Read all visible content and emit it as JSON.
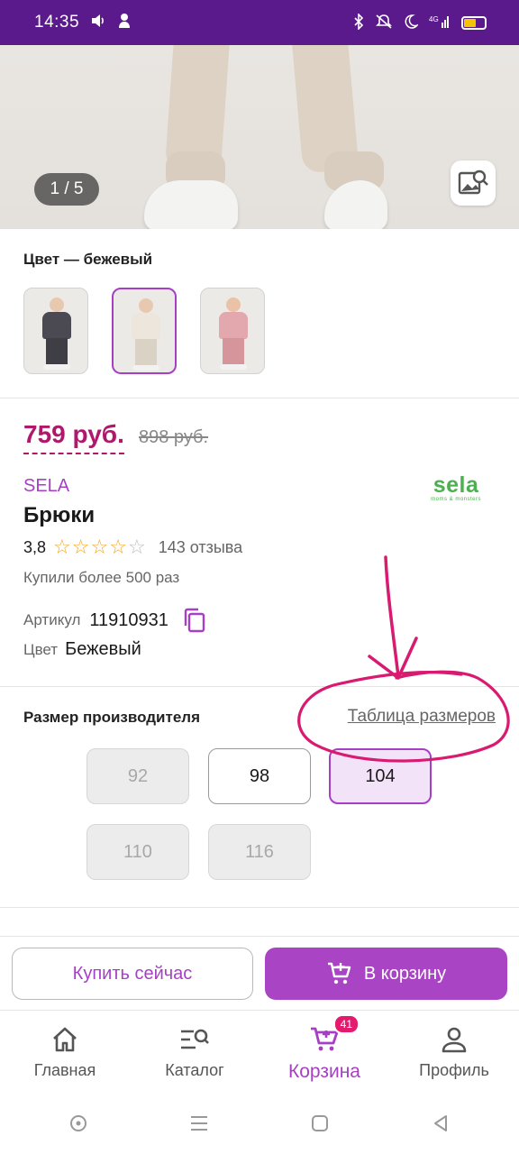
{
  "status_bar": {
    "time": "14:35"
  },
  "gallery": {
    "counter": "1 / 5"
  },
  "color_section": {
    "title": "Цвет — бежевый",
    "swatches": [
      {
        "name": "dark-grey",
        "body": "#4b4a52",
        "legs": "#3f3e45"
      },
      {
        "name": "beige",
        "body": "#ece6dd",
        "legs": "#dbd2c6",
        "selected": true
      },
      {
        "name": "pink",
        "body": "#e2a8ad",
        "legs": "#d6959b"
      }
    ]
  },
  "product": {
    "price": "759 руб.",
    "old_price": "898 руб.",
    "brand": "SELA",
    "brand_logo": "sela",
    "brand_logo_sub": "moms & monsters",
    "title": "Брюки",
    "rating_value": "3,8",
    "rating_stars": 4,
    "reviews": "143 отзыва",
    "bought": "Купили более 500 раз",
    "article_label": "Артикул",
    "article_value": "11910931",
    "color_label": "Цвет",
    "color_value": "Бежевый"
  },
  "sizes": {
    "title": "Размер производителя",
    "table_link": "Таблица размеров",
    "options": [
      {
        "label": "92",
        "state": "disabled"
      },
      {
        "label": "98",
        "state": "available"
      },
      {
        "label": "104",
        "state": "selected"
      },
      {
        "label": "110",
        "state": "disabled"
      },
      {
        "label": "116",
        "state": "disabled"
      }
    ]
  },
  "actions": {
    "buy_now": "Купить сейчас",
    "to_cart": "В корзину"
  },
  "bottom_nav": {
    "items": [
      {
        "label": "Главная",
        "icon": "home-icon"
      },
      {
        "label": "Каталог",
        "icon": "catalog-search-icon"
      },
      {
        "label": "Корзина",
        "icon": "cart-icon",
        "badge": "41",
        "active": true
      },
      {
        "label": "Профиль",
        "icon": "profile-icon"
      }
    ]
  },
  "colors": {
    "accent": "#a73fc5",
    "price": "#b0196b",
    "status_bar": "#5b1a8c",
    "annotation": "#d81b70"
  }
}
